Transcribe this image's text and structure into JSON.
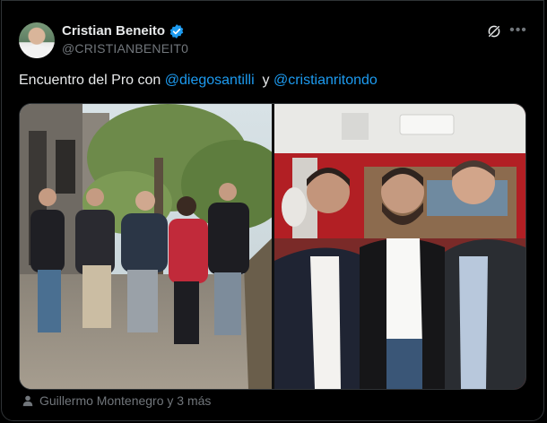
{
  "author": {
    "name": "Cristian Beneito",
    "handle": "@CRISTIANBENEIT0",
    "verified": true
  },
  "icons": {
    "verified": "verified-badge-icon",
    "grok": "grok-icon",
    "more": "more-options-icon",
    "tagged": "person-tag-icon"
  },
  "tweet": {
    "text_prefix": "Encuentro del Pro con ",
    "mention_1": "@diegosantilli",
    "connector": "  y ",
    "mention_2": "@cristianritondo"
  },
  "media": {
    "left_photo": "group-walking-on-sidewalk-photo",
    "right_photo": "three-men-posing-in-red-room-photo"
  },
  "footer": {
    "tagged_text": "Guillermo Montenegro y 3 más"
  },
  "colors": {
    "background": "#000000",
    "text": "#e7e9ea",
    "muted": "#71767b",
    "accent": "#1d9bf0",
    "border": "#2f3336"
  }
}
